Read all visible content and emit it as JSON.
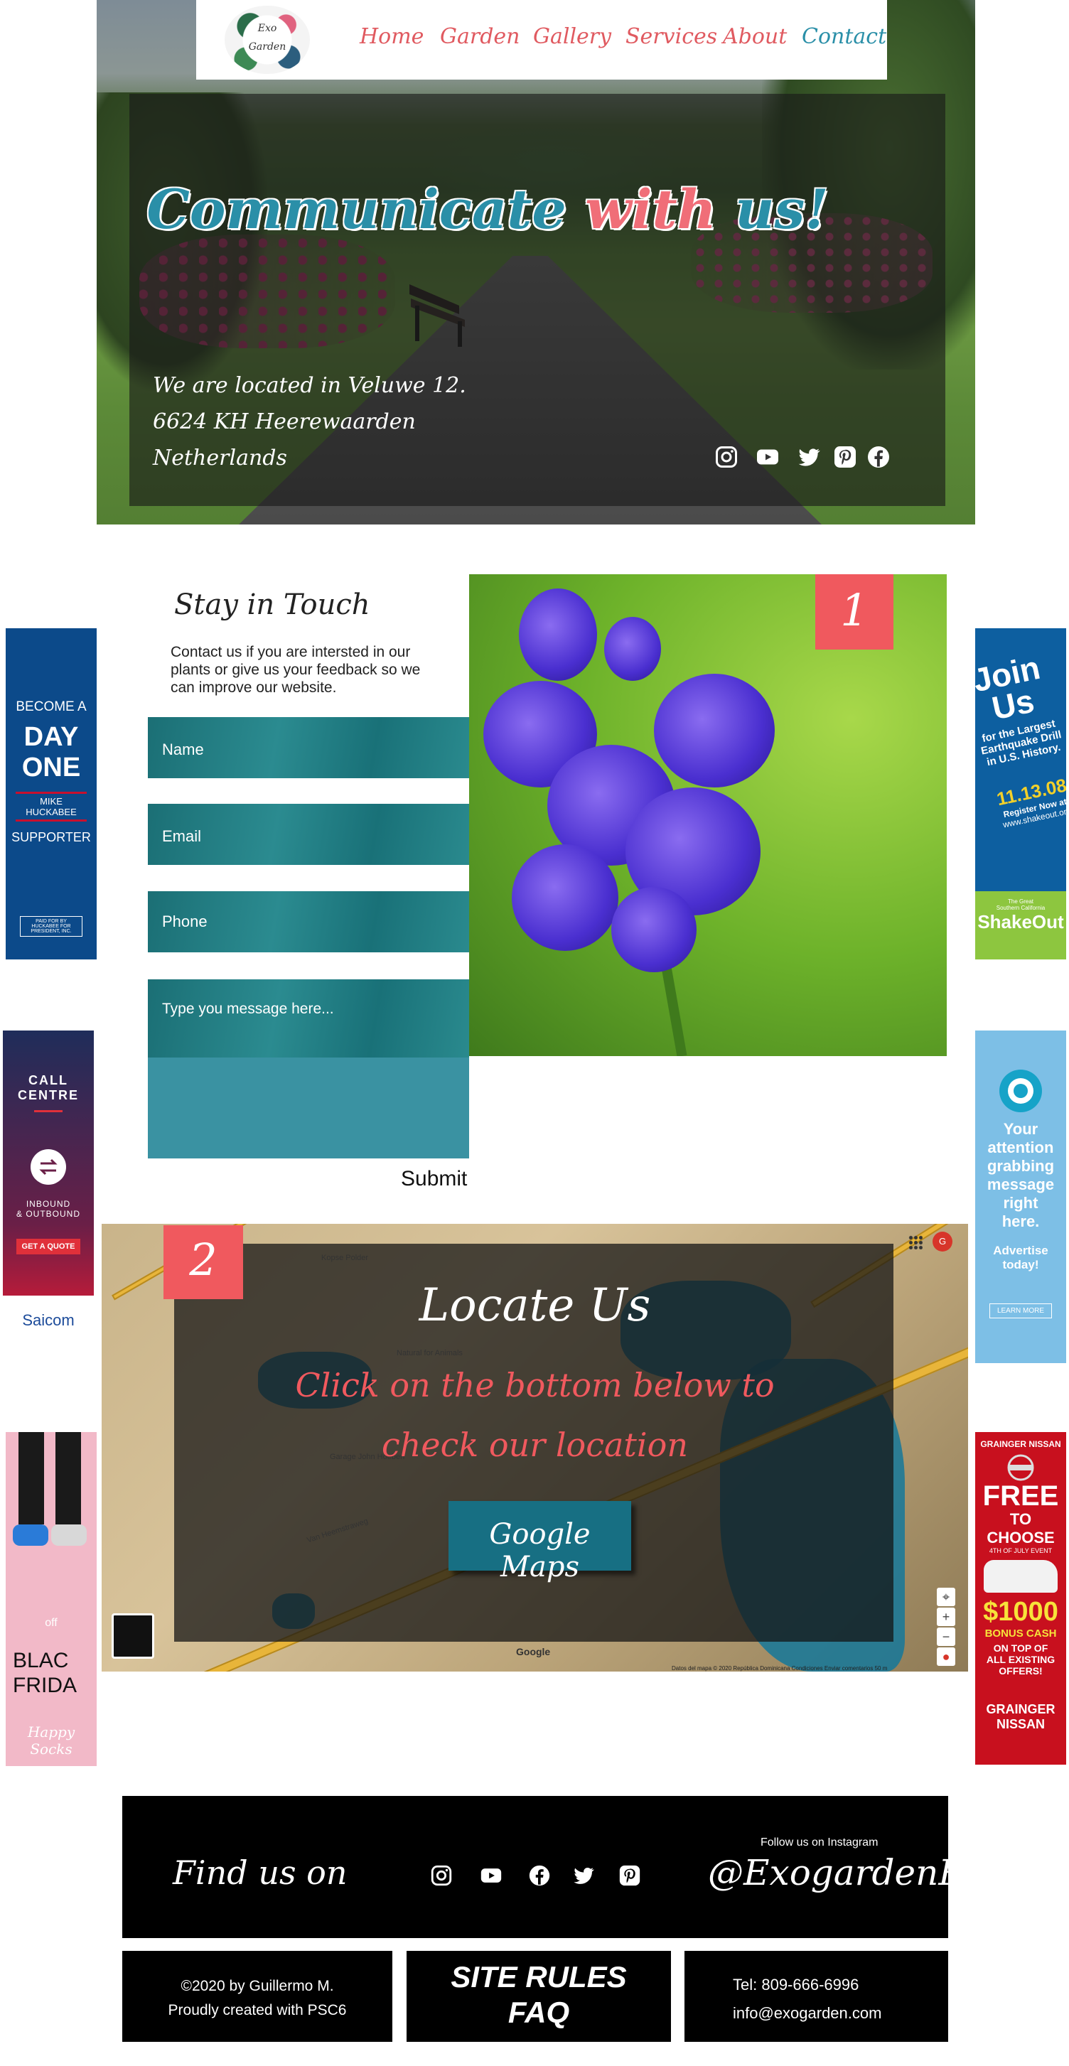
{
  "nav": {
    "logo_line1": "Exo",
    "logo_line2": "Garden",
    "items": [
      "Home",
      "Garden",
      "Gallery",
      "Services",
      "About",
      "Contact"
    ],
    "active": "Contact"
  },
  "hero": {
    "title_part1": "Communicate",
    "title_part2": "with",
    "title_part3": "us!",
    "address_line1": "We are located in Veluwe 12.",
    "address_line2": "6624 KH Heerewaarden",
    "address_line3": "Netherlands",
    "social_icons": [
      "instagram-icon",
      "youtube-icon",
      "twitter-icon",
      "pinterest-icon",
      "facebook-icon"
    ]
  },
  "contact": {
    "title": "Stay in Touch",
    "description": "Contact us if you are intersted in our plants or give us your feedback so we can improve our website.",
    "name_placeholder": "Name",
    "email_placeholder": "Email",
    "phone_placeholder": "Phone",
    "message_placeholder": "Type you message here...",
    "submit_label": "Submit",
    "badge": "1"
  },
  "ads": {
    "left": [
      {
        "lines": [
          "BECOME A",
          "DAY",
          "ONE",
          "MIKE HUCKABEE",
          "SUPPORTER",
          "PAID FOR BY HUCKABEE FOR PRESIDENT, INC."
        ]
      },
      {
        "lines": [
          "CALL",
          "CENTRE",
          "INBOUND",
          "& OUTBOUND",
          "GET A QUOTE",
          "Saicom"
        ]
      },
      {
        "lines": [
          "off",
          "BLAC",
          "FRIDA",
          "Happy Socks"
        ]
      }
    ],
    "right": [
      {
        "lines": [
          "Join",
          "Us",
          "for the Largest",
          "Earthquake Drill",
          "in U.S. History.",
          "11.13.08",
          "Register Now at",
          "www.shakeout.org",
          "The Great",
          "Southern California",
          "ShakeOut"
        ]
      },
      {
        "lines": [
          "Your",
          "attention",
          "grabbing",
          "message",
          "right",
          "here.",
          "Advertise",
          "today!",
          "LEARN MORE"
        ]
      },
      {
        "lines": [
          "GRAINGER NISSAN",
          "FREE",
          "TO CHOOSE",
          "4TH OF JULY EVENT",
          "$1000",
          "BONUS CASH",
          "ON TOP OF",
          "ALL EXISTING",
          "OFFERS!",
          "GRAINGER",
          "NISSAN"
        ]
      }
    ]
  },
  "map": {
    "badge": "2",
    "title": "Locate Us",
    "subtitle_line1": "Click on the bottom below to",
    "subtitle_line2": "check our location",
    "button_label": "Google Maps",
    "labels": [
      "Kopse Polder",
      "Natural for Animals",
      "Garage John Hoeben",
      "Van Heemstraweg",
      "Google"
    ],
    "attribution": "Datos del mapa © 2020   República Dominicana   Condiciones   Enviar comentarios   50 m",
    "avatar_letter": "G"
  },
  "footer": {
    "find_us": "Find us on",
    "social_icons": [
      "instagram-icon",
      "youtube-icon",
      "facebook-icon",
      "twitter-icon",
      "pinterest-icon"
    ],
    "follow_label": "Follow us on Instagram",
    "handle": "@ExogardenRD",
    "copyright_line1": "©2020 by Guillermo M.",
    "copyright_line2": "Proudly created with PSC6",
    "rules_line1": "SITE RULES",
    "rules_line2": "FAQ",
    "phone": "Tel: 809-666-6996",
    "email": "info@exogarden.com"
  },
  "colors": {
    "accent_red": "#f0595e",
    "accent_teal": "#2a8fa8",
    "form_teal": "#1b6f75",
    "footer_bg": "#000000"
  }
}
